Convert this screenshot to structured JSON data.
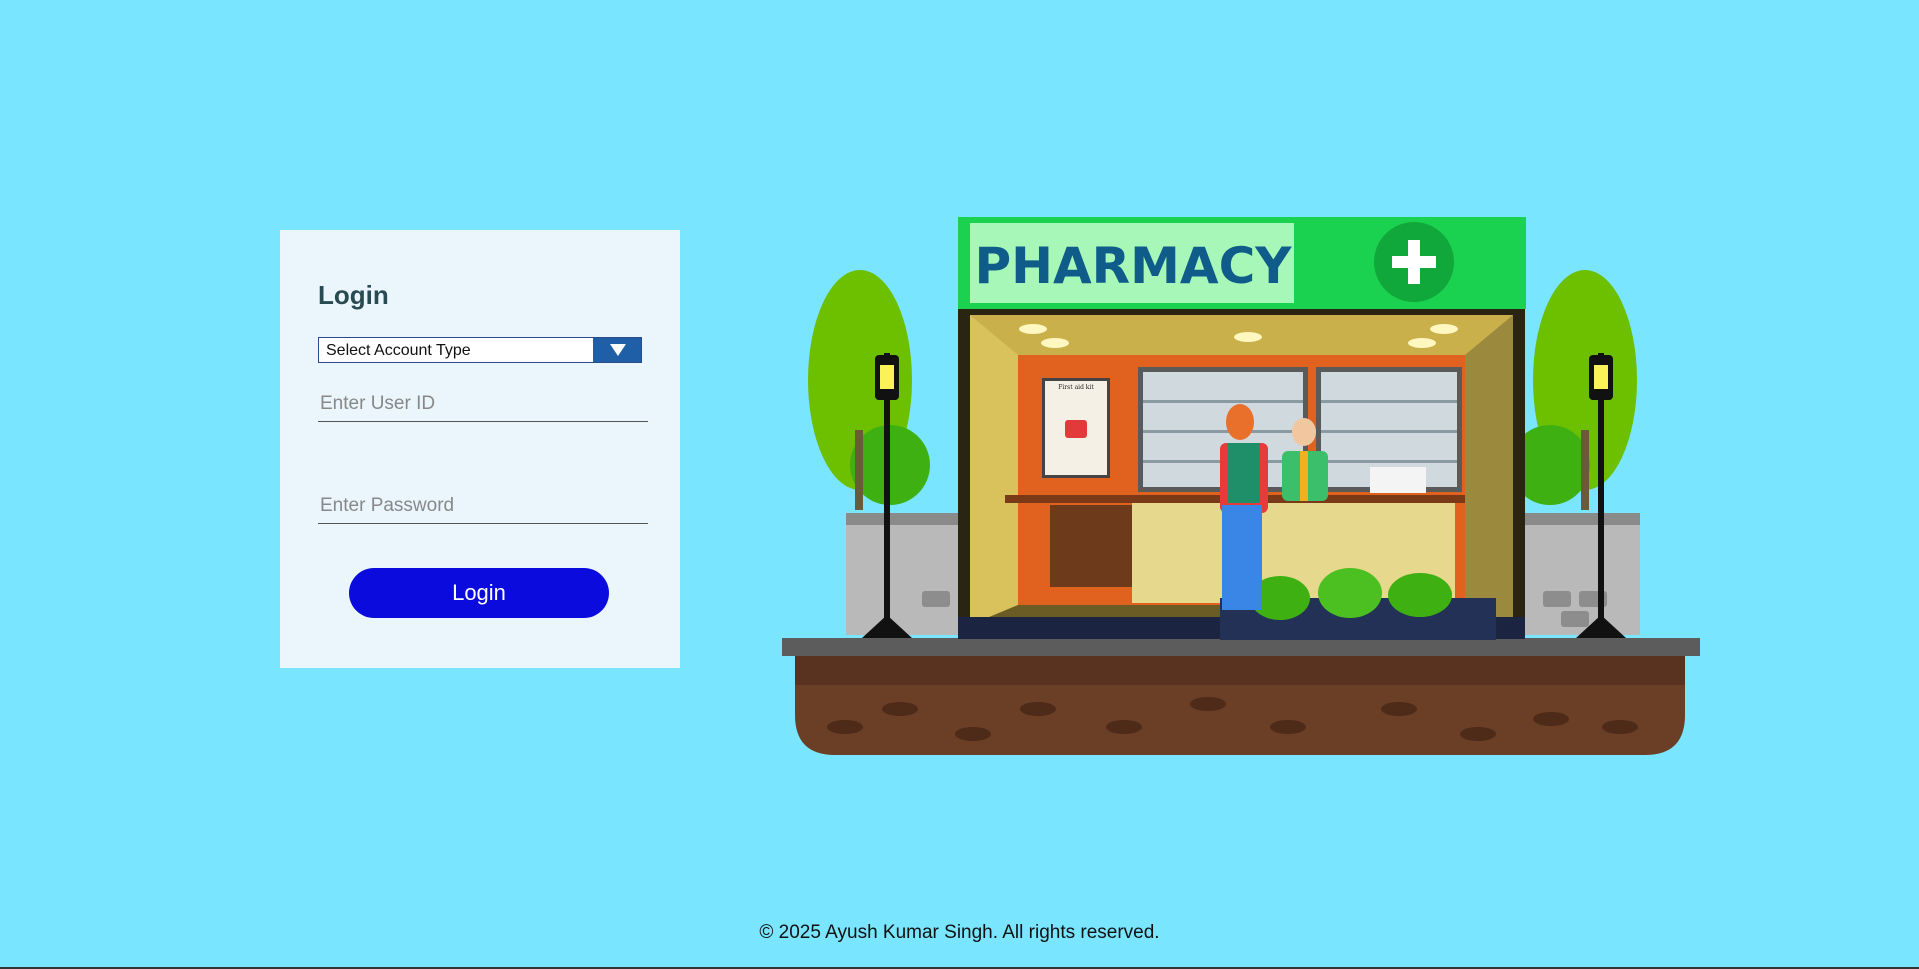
{
  "login": {
    "title": "Login",
    "account_type": {
      "selected": "Select Account Type"
    },
    "user_id": {
      "value": "",
      "placeholder": "Enter User ID"
    },
    "password": {
      "value": "",
      "placeholder": "Enter Password"
    },
    "submit_label": "Login"
  },
  "illustration": {
    "sign_text": "PHARMACY",
    "poster_text": "First aid kit"
  },
  "footer": {
    "copyright": "© 2025 Ayush Kumar Singh. All rights reserved."
  },
  "colors": {
    "background": "#79e5fe",
    "card": "#eaf6fc",
    "button": "#0a0bdc",
    "select_arrow": "#1f5fa8",
    "sign_green": "#1bd150",
    "sign_text": "#0f5c8a"
  },
  "icons": [
    "chevron-down-icon",
    "plus-icon"
  ]
}
